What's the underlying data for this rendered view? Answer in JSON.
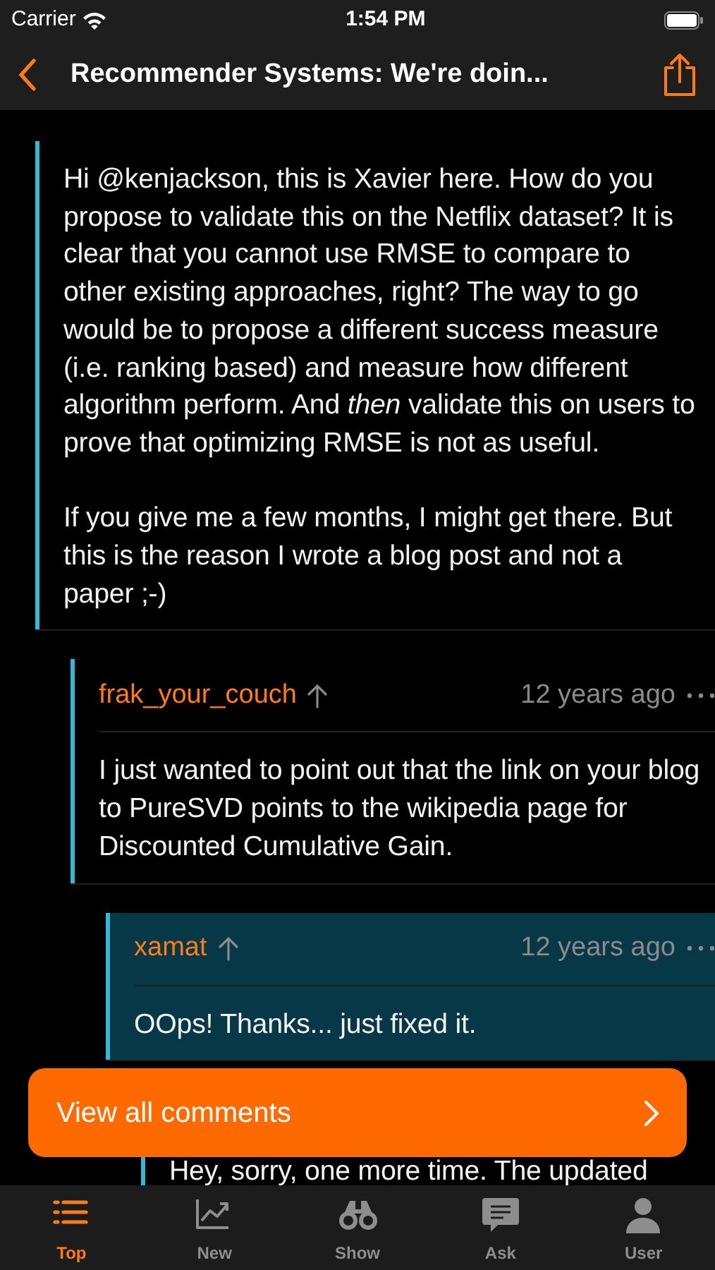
{
  "status_bar": {
    "carrier": "Carrier",
    "time": "1:54 PM"
  },
  "nav": {
    "title": "Recommender Systems: We're doin..."
  },
  "comments": [
    {
      "paragraphs": [
        "Hi @kenjackson, this is Xavier here. How do you propose to validate this on the Netflix dataset? It is clear that you cannot use RMSE to compare to other existing approaches, right? The way to go would be to propose a different success measure (i.e. ranking based) and measure how different algorithm perform. And *then* validate this on users to prove that optimizing RMSE is not as useful.",
        "If you give me a few months, I might get there. But this is the reason I wrote a blog post and not a paper ;-)"
      ],
      "highlighted": false,
      "children": [
        {
          "author": "frak_your_couch",
          "time": "12 years ago",
          "paragraphs": [
            "I just wanted to point out that the link on your blog to PureSVD points to the wikipedia page for Discounted Cumulative Gain."
          ],
          "highlighted": false,
          "children": [
            {
              "author": "xamat",
              "time": "12 years ago",
              "paragraphs": [
                "OOps! Thanks... just fixed it."
              ],
              "highlighted": true,
              "children": [
                {
                  "paragraphs": [
                    "Hey, sorry, one more time.  The updated"
                  ],
                  "highlighted": false
                }
              ]
            }
          ]
        }
      ]
    }
  ],
  "floating_button": {
    "label": "View all comments"
  },
  "tabs": [
    {
      "label": "Top",
      "selected": true
    },
    {
      "label": "New",
      "selected": false
    },
    {
      "label": "Show",
      "selected": false
    },
    {
      "label": "Ask",
      "selected": false
    },
    {
      "label": "User",
      "selected": false
    }
  ]
}
